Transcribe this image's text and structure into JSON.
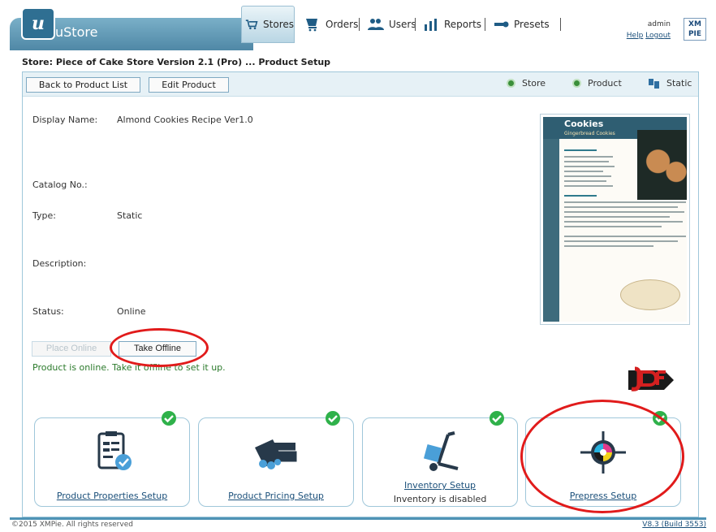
{
  "app": {
    "name": "uStore",
    "logo_letter": "u"
  },
  "nav": {
    "stores": "Stores",
    "orders": "Orders",
    "users": "Users",
    "reports": "Reports",
    "presets": "Presets"
  },
  "user": {
    "name": "admin",
    "help": "Help",
    "logout": "Logout"
  },
  "xmpie_logo": {
    "line1": "XM",
    "line2": "PIE"
  },
  "breadcrumb": "Store: Piece of Cake Store Version 2.1 (Pro) ... Product Setup",
  "toolbar": {
    "back_label": "Back to Product List",
    "edit_label": "Edit Product",
    "views": {
      "store": "Store",
      "product": "Product",
      "static": "Static"
    }
  },
  "product": {
    "display_name_label": "Display Name:",
    "display_name": "Almond Cookies Recipe Ver1.0",
    "catalog_label": "Catalog No.:",
    "catalog_no": "",
    "type_label": "Type:",
    "type": "Static",
    "description_label": "Description:",
    "description": "",
    "status_label": "Status:",
    "status": "Online"
  },
  "thumbnail": {
    "title": "Cookies",
    "subtitle": "Gingerbread Cookies"
  },
  "actions": {
    "place_online": "Place Online",
    "take_offline": "Take Offline",
    "status_message": "Product is online. Take it offline to set it up."
  },
  "tiles": [
    {
      "link": "Product Properties Setup",
      "note": "",
      "icon": "clipboard-check-icon",
      "complete": true
    },
    {
      "link": "Product Pricing Setup",
      "note": "",
      "icon": "price-tag-icon",
      "complete": true
    },
    {
      "link": "Inventory Setup",
      "note": "Inventory is disabled",
      "icon": "hand-truck-icon",
      "complete": true
    },
    {
      "link": "Prepress Setup",
      "note": "",
      "icon": "registration-mark-icon",
      "complete": true
    }
  ],
  "footer": {
    "copyright": "©2015 XMPie. All rights reserved",
    "version": "V8.3 (Build 3553)"
  },
  "colors": {
    "accent": "#4f88a6",
    "link": "#1a4f7a",
    "success": "#2fb14a",
    "annotation": "#e11b1b"
  }
}
